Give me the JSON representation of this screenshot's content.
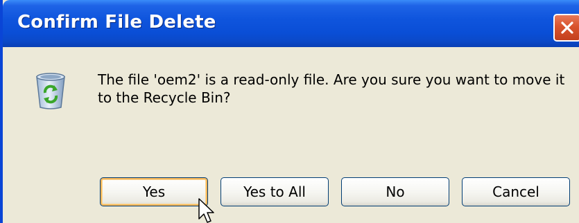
{
  "window": {
    "title": "Confirm File Delete",
    "close_icon": "close-icon"
  },
  "message": {
    "icon": "recycle-bin-icon",
    "text": "The file 'oem2' is a read-only file. Are you sure you want to move it to the Recycle Bin?"
  },
  "buttons": {
    "yes": "Yes",
    "yes_to_all": "Yes to All",
    "no": "No",
    "cancel": "Cancel"
  },
  "colors": {
    "titlebar": "#0a4ed6",
    "dialog_bg": "#ece9d8",
    "close_button": "#d9532d",
    "default_button_focus": "#f8b85a"
  },
  "cursor": {
    "icon": "mouse-pointer-icon"
  }
}
